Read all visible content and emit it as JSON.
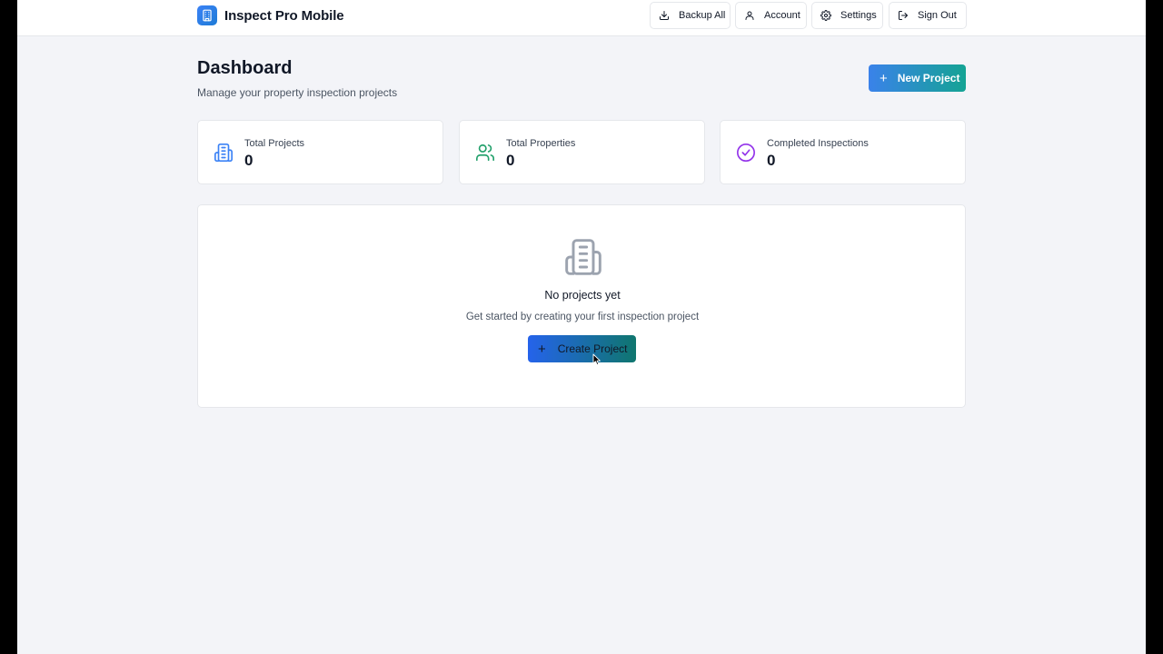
{
  "app": {
    "title": "Inspect Pro Mobile",
    "logo_icon": "building-icon"
  },
  "header": {
    "buttons": [
      {
        "label": "Backup All",
        "icon": "download-icon"
      },
      {
        "label": "Account",
        "icon": "user-icon"
      },
      {
        "label": "Settings",
        "icon": "gear-icon"
      },
      {
        "label": "Sign Out",
        "icon": "sign-out-icon"
      }
    ]
  },
  "page": {
    "title": "Dashboard",
    "subtitle": "Manage your property inspection projects",
    "new_project_plus": "+",
    "new_project_label": "New Project"
  },
  "stats": [
    {
      "label": "Total Projects",
      "value": "0",
      "icon": "building-icon",
      "color": "#3b82f6"
    },
    {
      "label": "Total Properties",
      "value": "0",
      "icon": "users-icon",
      "color": "#22a06b"
    },
    {
      "label": "Completed Inspections",
      "value": "0",
      "icon": "check-circle-icon",
      "color": "#9333ea"
    }
  ],
  "empty_state": {
    "icon": "building-icon",
    "title": "No projects yet",
    "description": "Get started by creating your first inspection project",
    "button_plus": "+",
    "button_label": "Create Project"
  },
  "colors": {
    "accent_blue": "#3a82ea",
    "accent_teal": "#14a394",
    "background": "#f3f4f8"
  }
}
